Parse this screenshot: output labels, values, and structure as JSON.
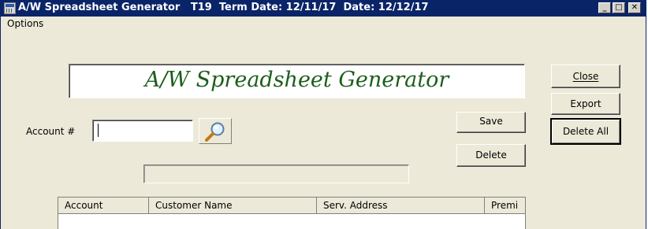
{
  "window": {
    "title": "A/W Spreadsheet Generator   T19  Term Date: 12/11/17  Date: 12/12/17",
    "minimize_label": "_",
    "maximize_label": "□",
    "close_label": "✕"
  },
  "menu": {
    "options": "Options"
  },
  "banner": {
    "text": "A/W Spreadsheet Generator"
  },
  "account": {
    "label": "Account #",
    "value": ""
  },
  "buttons": {
    "close": "Close",
    "export": "Export",
    "delete_all": "Delete All",
    "save": "Save",
    "delete": "Delete"
  },
  "grid": {
    "columns": [
      "Account",
      "Customer Name",
      "Serv. Address",
      "Premi"
    ]
  },
  "colors": {
    "title_bar": "#0a2468",
    "banner_text": "#1c5e1c",
    "window_bg": "#ece9d8"
  },
  "icons": {
    "search": "magnifier-icon",
    "app": "spreadsheet-app-icon"
  }
}
